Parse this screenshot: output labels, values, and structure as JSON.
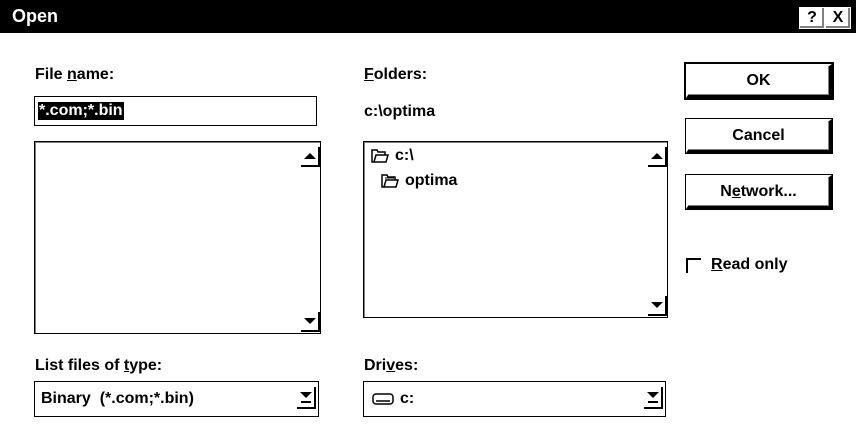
{
  "window": {
    "title": "Open",
    "help_label": "?",
    "close_label": "X"
  },
  "file_name": {
    "label_pre": "File ",
    "label_ul": "n",
    "label_post": "ame:",
    "value": "*.com;*.bin",
    "list_items": []
  },
  "folders": {
    "label_ul": "F",
    "label_post": "olders:",
    "current_path": "c:\\optima",
    "items": [
      {
        "name": "c:\\",
        "icon": "open-folder-icon"
      },
      {
        "name": "optima",
        "icon": "open-folder-icon"
      }
    ]
  },
  "file_type": {
    "label_pre": "List files of ",
    "label_ul": "t",
    "label_post": "ype:",
    "selected": "Binary  (*.com;*.bin)"
  },
  "drives": {
    "label_pre": "Dri",
    "label_ul": "v",
    "label_post": "es:",
    "selected": "c:",
    "icon": "drive-icon"
  },
  "buttons": {
    "ok": "OK",
    "cancel": "Cancel",
    "network_pre": "N",
    "network_ul": "e",
    "network_post": "twork..."
  },
  "read_only": {
    "label_ul": "R",
    "label_post": "ead only",
    "checked": false
  }
}
